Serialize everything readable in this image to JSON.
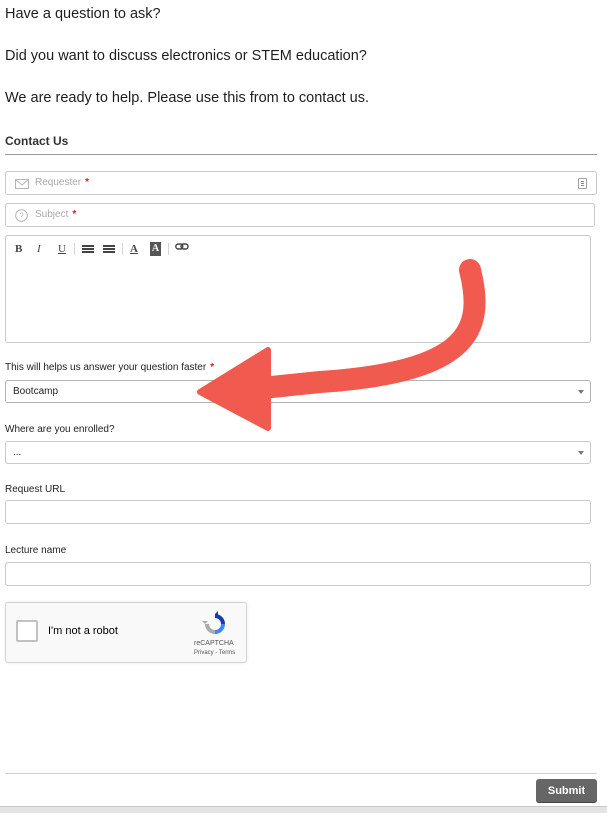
{
  "intro": {
    "line1": "Have a question to ask?",
    "line2": "Did you want to discuss electronics or STEM education?",
    "line3": "We are ready to help. Please use this from to contact us."
  },
  "form": {
    "section_title": "Contact Us",
    "requester": {
      "placeholder": "Requester",
      "required_mark": "*",
      "icon": "envelope-icon",
      "right_icon": "contact-card-icon"
    },
    "subject": {
      "placeholder": "Subject",
      "required_mark": "*",
      "icon": "question-circle-icon"
    },
    "editor_toolbar": {
      "bold": "B",
      "italic": "I",
      "underline": "U",
      "unordered_list": "bulleted-list-icon",
      "ordered_list": "numbered-list-icon",
      "text_color": "A",
      "background_color": "A",
      "link": "link-icon"
    },
    "help_field": {
      "label": "This will helps us answer your question faster",
      "required_mark": "*",
      "value": "Bootcamp"
    },
    "enrolled_field": {
      "label": "Where are you enrolled?",
      "value": "..."
    },
    "url_field": {
      "label": "Request URL",
      "value": ""
    },
    "lecture_field": {
      "label": "Lecture name",
      "value": ""
    },
    "recaptcha": {
      "label": "I'm not a robot",
      "brand": "reCAPTCHA",
      "links": "Privacy - Terms"
    },
    "submit_label": "Submit"
  },
  "annotation": {
    "arrow_color": "#f05a4f"
  },
  "colors": {
    "required": "#cc1f1f",
    "submit_bg": "#666666"
  }
}
